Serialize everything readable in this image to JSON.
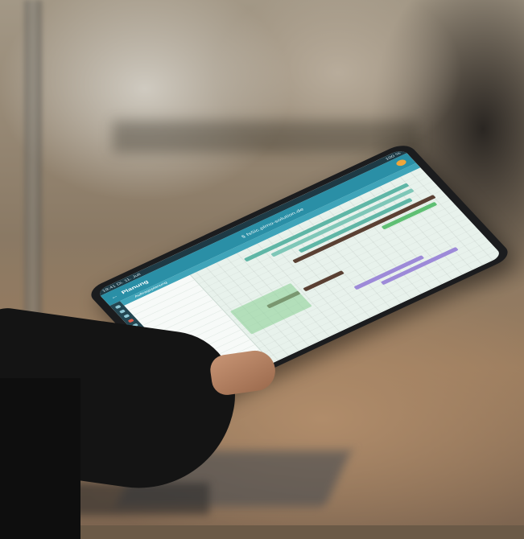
{
  "app": {
    "title": "Planung",
    "url": "§ fs5ic.plmo-solution.de",
    "status_left": "19:41  Di. 11. Juli",
    "status_right": "100 %",
    "subbar": "Auftragsplanung"
  },
  "rows": [
    "",
    "",
    "",
    "",
    "",
    "",
    "",
    "",
    "",
    "",
    "",
    "",
    "",
    "",
    ""
  ],
  "bars": [
    {
      "label": "",
      "cls": "teal"
    },
    {
      "label": "",
      "cls": "teal2"
    },
    {
      "label": "",
      "cls": "teal"
    },
    {
      "label": "",
      "cls": "brown"
    },
    {
      "label": "",
      "cls": "green"
    },
    {
      "label": "",
      "cls": "brown"
    },
    {
      "label": "",
      "cls": "brown"
    },
    {
      "label": "",
      "cls": "purple"
    },
    {
      "label": "",
      "cls": "purple"
    }
  ],
  "colors": {
    "accent": "#2a8fa6",
    "sidebar": "#244651"
  }
}
